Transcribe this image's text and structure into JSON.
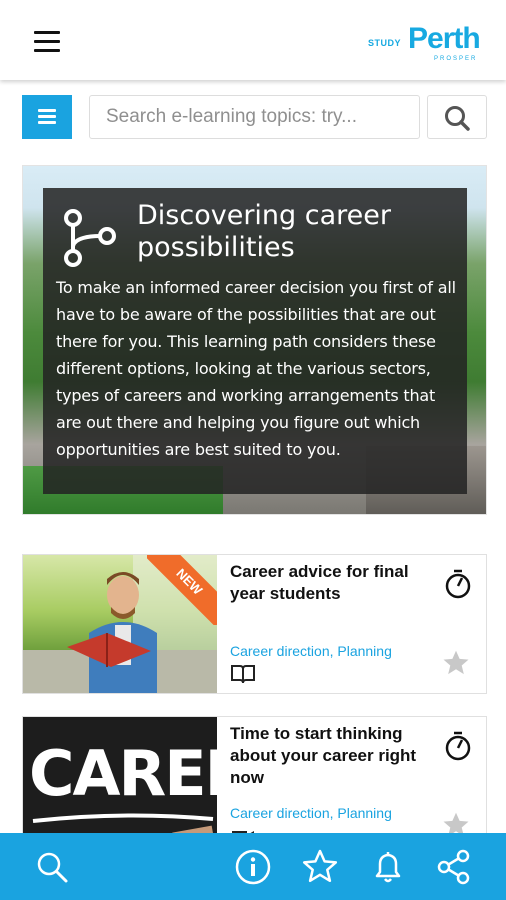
{
  "header": {
    "logo": {
      "study": "STUDY",
      "perth": "Perth",
      "prosper": "PROSPER"
    }
  },
  "search": {
    "placeholder": "Search e-learning topics: try..."
  },
  "hero": {
    "title": "Discovering career possibilities",
    "description": "To make an informed career decision you first of all have to be aware of the possibilities that are out there for you. This learning path considers these different options, looking at the various sectors, types of careers and working arrangements that are out there and helping you figure out which opportunities are best suited to you."
  },
  "cards": [
    {
      "title": "Career advice for final year students",
      "tags": "Career direction, Planning",
      "badge": "NEW",
      "type_icon": "book-icon"
    },
    {
      "title": "Time to start thinking about your career right now",
      "tags": "Career direction, Planning",
      "thumb_text": "CAREER",
      "type_icon": "video-icon"
    }
  ],
  "bottom_nav": [
    "search-icon",
    "info-icon",
    "star-icon",
    "bell-icon",
    "share-icon"
  ],
  "colors": {
    "accent": "#1aa3e0",
    "badge": "#f06c2a",
    "panel": "#232323"
  }
}
